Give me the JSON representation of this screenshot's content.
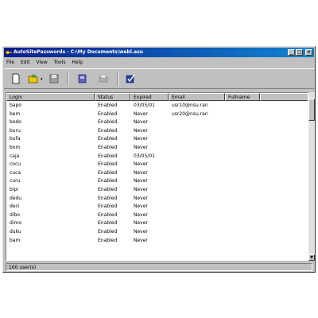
{
  "window": {
    "title": "AutoSitePasswords - C:\\My Documents\\webl.asu",
    "min_label": "_",
    "max_label": "□",
    "close_label": "×"
  },
  "menu": [
    {
      "label": "File"
    },
    {
      "label": "Edit"
    },
    {
      "label": "View"
    },
    {
      "label": "Tools"
    },
    {
      "label": "Help"
    }
  ],
  "toolbar": {
    "icons": [
      "new-file-icon",
      "open-folder-icon",
      "save-icon",
      "find-icon",
      "print-icon",
      "check-icon"
    ],
    "dropdown_arrow": "▾"
  },
  "list": {
    "columns": [
      "Login",
      "Status",
      "Expired",
      "Email",
      "Fullname"
    ],
    "rows": [
      [
        "bapo",
        "Enabled",
        "03/05/01",
        "usr10@nsu.ran",
        ""
      ],
      [
        "bem",
        "Enabled",
        "Never",
        "usr20@nsu.ran",
        ""
      ],
      [
        "bodo",
        "Enabled",
        "Never",
        "",
        ""
      ],
      [
        "buru",
        "Enabled",
        "Never",
        "",
        ""
      ],
      [
        "bufa",
        "Enabled",
        "Never",
        "",
        ""
      ],
      [
        "bom",
        "Enabled",
        "Never",
        "",
        ""
      ],
      [
        "caja",
        "Enabled",
        "03/05/01",
        "",
        ""
      ],
      [
        "cocu",
        "Enabled",
        "Never",
        "",
        ""
      ],
      [
        "cuca",
        "Enabled",
        "Never",
        "",
        ""
      ],
      [
        "curu",
        "Enabled",
        "Never",
        "",
        ""
      ],
      [
        "bipi",
        "Enabled",
        "Never",
        "",
        ""
      ],
      [
        "dedu",
        "Enabled",
        "Never",
        "",
        ""
      ],
      [
        "deci",
        "Enabled",
        "Never",
        "",
        ""
      ],
      [
        "dibo",
        "Enabled",
        "Never",
        "",
        ""
      ],
      [
        "dimo",
        "Enabled",
        "Never",
        "",
        ""
      ],
      [
        "duku",
        "Enabled",
        "Never",
        "",
        ""
      ],
      [
        "bam",
        "Enabled",
        "Never",
        "",
        ""
      ]
    ]
  },
  "scrollbar": {
    "up": "▲",
    "down": "▼"
  },
  "status": {
    "text": "160 user(s)"
  },
  "colors": {
    "title_start": "#0a1e8c",
    "title_end": "#1084d0",
    "face": "#c0c0c0"
  }
}
